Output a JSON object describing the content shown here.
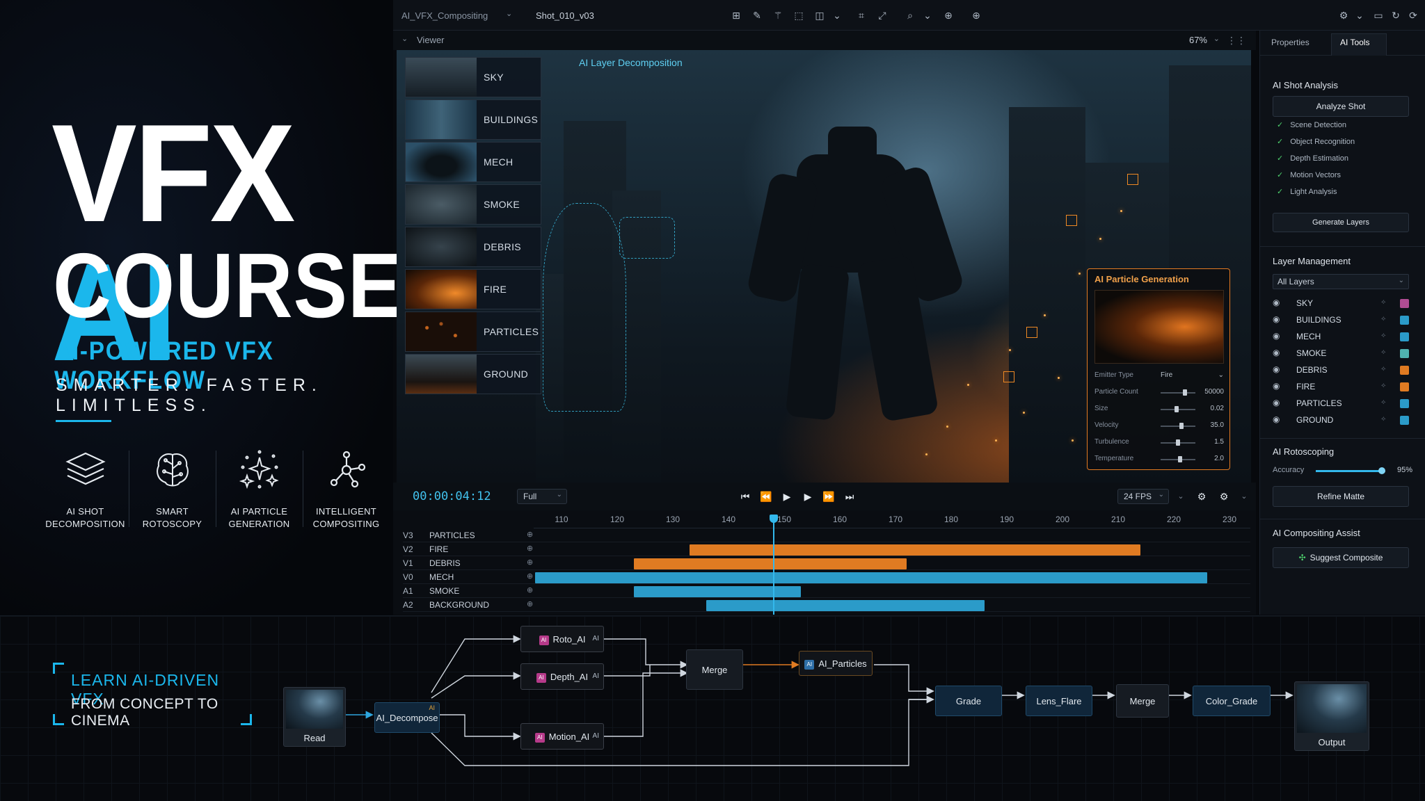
{
  "promo": {
    "title_vfx": "VFX",
    "title_ai": "AI",
    "title_courses": "COURSES",
    "subtitle": "AI-POWERED VFX WORKFLOW",
    "tagline": "SMARTER. FASTER. LIMITLESS.",
    "features": [
      {
        "line1": "AI SHOT",
        "line2": "DECOMPOSITION",
        "icon": "layers-icon"
      },
      {
        "line1": "SMART",
        "line2": "ROTOSCOPY",
        "icon": "brain-icon"
      },
      {
        "line1": "AI PARTICLE",
        "line2": "GENERATION",
        "icon": "sparkles-icon"
      },
      {
        "line1": "INTELLIGENT",
        "line2": "COMPOSITING",
        "icon": "nodes-icon"
      }
    ],
    "learn_line1": "LEARN AI-DRIVEN VFX",
    "learn_line2": "FROM CONCEPT TO CINEMA",
    "accent_color": "#1bb7ec"
  },
  "topbar": {
    "project": "AI_VFX_Compositing",
    "shot": "Shot_010_v03"
  },
  "viewer": {
    "label": "Viewer",
    "zoom": "67%",
    "decomp_label": "AI Layer Decomposition",
    "layers": [
      "SKY",
      "BUILDINGS",
      "MECH",
      "SMOKE",
      "DEBRIS",
      "FIRE",
      "PARTICLES",
      "GROUND"
    ]
  },
  "particle_gen": {
    "title": "AI Particle Generation",
    "emitter_label": "Emitter Type",
    "emitter_value": "Fire",
    "params": [
      {
        "label": "Particle Count",
        "value": "50000",
        "fraction": 0.7
      },
      {
        "label": "Size",
        "value": "0.02",
        "fraction": 0.45
      },
      {
        "label": "Velocity",
        "value": "35.0",
        "fraction": 0.6
      },
      {
        "label": "Turbulence",
        "value": "1.5",
        "fraction": 0.5
      },
      {
        "label": "Temperature",
        "value": "2.0",
        "fraction": 0.55
      }
    ]
  },
  "transport": {
    "timecode": "00:00:04:12",
    "resolution": "Full",
    "fps": "24 FPS"
  },
  "timeline": {
    "ruler": [
      "110",
      "120",
      "130",
      "140",
      "150",
      "160",
      "170",
      "180",
      "190",
      "200",
      "210",
      "220",
      "230"
    ],
    "frame_start": 110,
    "frame_end": 230,
    "playhead_frame": 148,
    "tracks": [
      {
        "id": "V3",
        "name": "PARTICLES",
        "clip": null,
        "color": "#e07b22"
      },
      {
        "id": "V2",
        "name": "FIRE",
        "clip": [
          133,
          214
        ],
        "color": "#e07b22"
      },
      {
        "id": "V1",
        "name": "DEBRIS",
        "clip": [
          123,
          172
        ],
        "color": "#e07b22"
      },
      {
        "id": "V0",
        "name": "MECH",
        "clip": [
          100,
          226
        ],
        "color": "#2b9bc9"
      },
      {
        "id": "A1",
        "name": "SMOKE",
        "clip": [
          123,
          153
        ],
        "color": "#2b9bc9"
      },
      {
        "id": "A2",
        "name": "BACKGROUND",
        "clip": [
          136,
          186
        ],
        "color": "#2b9bc9"
      }
    ]
  },
  "rpanel": {
    "tab_properties": "Properties",
    "tab_ai_tools": "AI Tools",
    "shot_analysis_title": "AI Shot Analysis",
    "analyze_button": "Analyze Shot",
    "checks": [
      "Scene Detection",
      "Object Recognition",
      "Depth Estimation",
      "Motion Vectors",
      "Light Analysis"
    ],
    "generate_button": "Generate Layers",
    "layer_mgmt_title": "Layer Management",
    "layer_filter": "All Layers",
    "layers": [
      {
        "name": "SKY",
        "color": "#b04c93"
      },
      {
        "name": "BUILDINGS",
        "color": "#2b9bc9"
      },
      {
        "name": "MECH",
        "color": "#2b9bc9"
      },
      {
        "name": "SMOKE",
        "color": "#4fb3b0"
      },
      {
        "name": "DEBRIS",
        "color": "#e07b22"
      },
      {
        "name": "FIRE",
        "color": "#e07b22"
      },
      {
        "name": "PARTICLES",
        "color": "#2b9bc9"
      },
      {
        "name": "GROUND",
        "color": "#2b9bc9"
      }
    ],
    "roto_title": "AI Rotoscoping",
    "accuracy_label": "Accuracy",
    "accuracy_value": "95%",
    "accuracy_fraction": 0.95,
    "refine_button": "Refine Matte",
    "compositing_title": "AI Compositing Assist",
    "suggest_button": "Suggest Composite"
  },
  "nodes": {
    "read": "Read",
    "decompose": "AI_Decompose",
    "ai_tag": "AI",
    "roto": "Roto_AI",
    "depth": "Depth_AI",
    "motion": "Motion_AI",
    "merge1": "Merge",
    "particles": "AI_Particles",
    "grade": "Grade",
    "lens_flare": "Lens_Flare",
    "merge2": "Merge",
    "color_grade": "Color_Grade",
    "output": "Output"
  }
}
